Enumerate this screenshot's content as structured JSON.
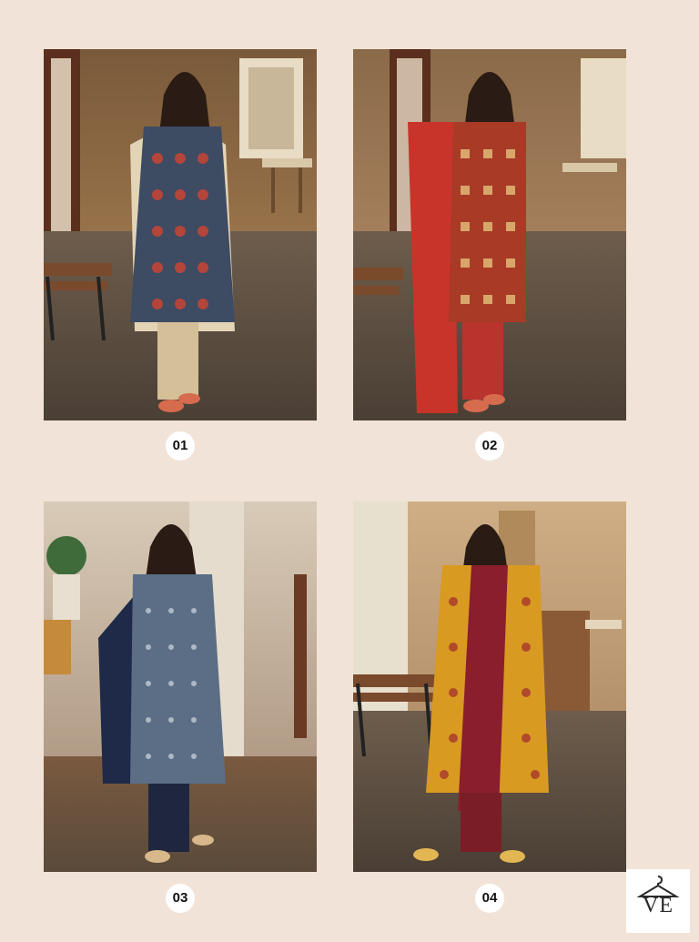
{
  "tiles": [
    {
      "label": "01",
      "theme": "navy-red print kurta, beige dupatta and palazzo",
      "outfit": "#3d4b63",
      "accent": "#b4453a",
      "dupatta": "#e3d4b6",
      "pants": "#d4bf98"
    },
    {
      "label": "02",
      "theme": "red print kurta with red dupatta",
      "outfit": "#a83a26",
      "accent": "#d8a66a",
      "dupatta": "#c9342a",
      "pants": "#b9342d"
    },
    {
      "label": "03",
      "theme": "slate blue print kurta with navy dupatta",
      "outfit": "#5b6e86",
      "accent": "#cfd8e2",
      "dupatta": "#1e2a47",
      "pants": "#1f2740"
    },
    {
      "label": "04",
      "theme": "mustard floral kurta with maroon dupatta",
      "outfit": "#d99a22",
      "accent": "#b04a2a",
      "dupatta": "#8a1e2c",
      "pants": "#7a1d26"
    }
  ],
  "logo": {
    "text": "VE",
    "icon": "hanger-icon"
  }
}
